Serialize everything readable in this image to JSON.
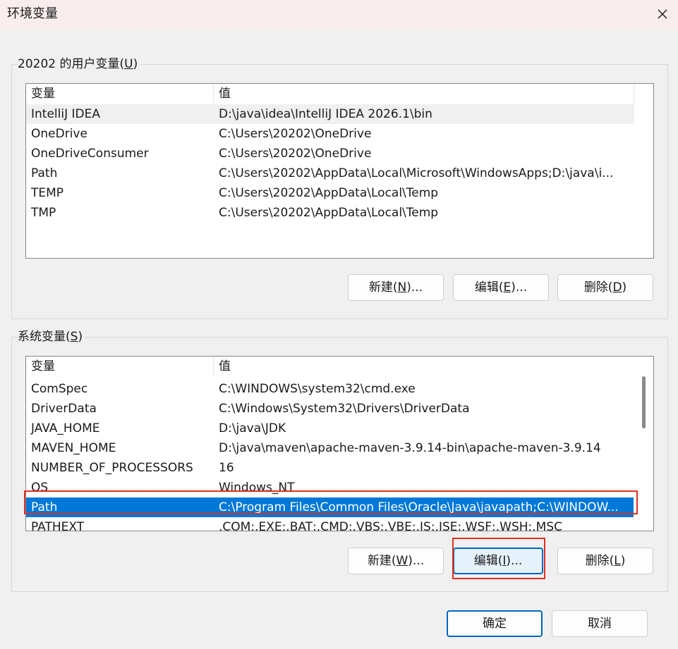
{
  "window": {
    "title": "环境变量",
    "close_icon": "close-icon"
  },
  "user_vars": {
    "group_label_pre": "20202 的用户变量(",
    "group_label_key": "U",
    "group_label_post": ")",
    "col_name": "变量",
    "col_value": "值",
    "rows": [
      {
        "name": "IntelliJ IDEA",
        "value": "D:\\java\\idea\\IntelliJ IDEA 2026.1\\bin"
      },
      {
        "name": "OneDrive",
        "value": "C:\\Users\\20202\\OneDrive"
      },
      {
        "name": "OneDriveConsumer",
        "value": "C:\\Users\\20202\\OneDrive"
      },
      {
        "name": "Path",
        "value": "C:\\Users\\20202\\AppData\\Local\\Microsoft\\WindowsApps;D:\\java\\i..."
      },
      {
        "name": "TEMP",
        "value": "C:\\Users\\20202\\AppData\\Local\\Temp"
      },
      {
        "name": "TMP",
        "value": "C:\\Users\\20202\\AppData\\Local\\Temp"
      }
    ],
    "new_pre": "新建(",
    "new_key": "N",
    "new_post": ")...",
    "edit_pre": "编辑(",
    "edit_key": "E",
    "edit_post": ")...",
    "delete_pre": "删除(",
    "delete_key": "D",
    "delete_post": ")"
  },
  "system_vars": {
    "group_label_pre": "系统变量(",
    "group_label_key": "S",
    "group_label_post": ")",
    "col_name": "变量",
    "col_value": "值",
    "rows": [
      {
        "name": "ComSpec",
        "value": "C:\\WINDOWS\\system32\\cmd.exe"
      },
      {
        "name": "DriverData",
        "value": "C:\\Windows\\System32\\Drivers\\DriverData"
      },
      {
        "name": "JAVA_HOME",
        "value": "D:\\java\\JDK"
      },
      {
        "name": "MAVEN_HOME",
        "value": "D:\\java\\maven\\apache-maven-3.9.14-bin\\apache-maven-3.9.14"
      },
      {
        "name": "NUMBER_OF_PROCESSORS",
        "value": "16"
      },
      {
        "name": "OS",
        "value": "Windows_NT"
      },
      {
        "name": "Path",
        "value": "C:\\Program Files\\Common Files\\Oracle\\Java\\javapath;C:\\WINDOW..."
      },
      {
        "name": "PATHEXT",
        "value": ".COM;.EXE;.BAT;.CMD;.VBS;.VBE;.JS;.JSE;.WSF;.WSH;.MSC"
      }
    ],
    "new_pre": "新建(",
    "new_key": "W",
    "new_post": ")...",
    "edit_pre": "编辑(",
    "edit_key": "I",
    "edit_post": ")...",
    "delete_pre": "删除(",
    "delete_key": "L",
    "delete_post": ")"
  },
  "footer": {
    "ok_label": "确定",
    "cancel_label": "取消"
  },
  "colors": {
    "selection": "#0078d7",
    "annotation": "#e0301e",
    "focus_border": "#0067c0"
  }
}
